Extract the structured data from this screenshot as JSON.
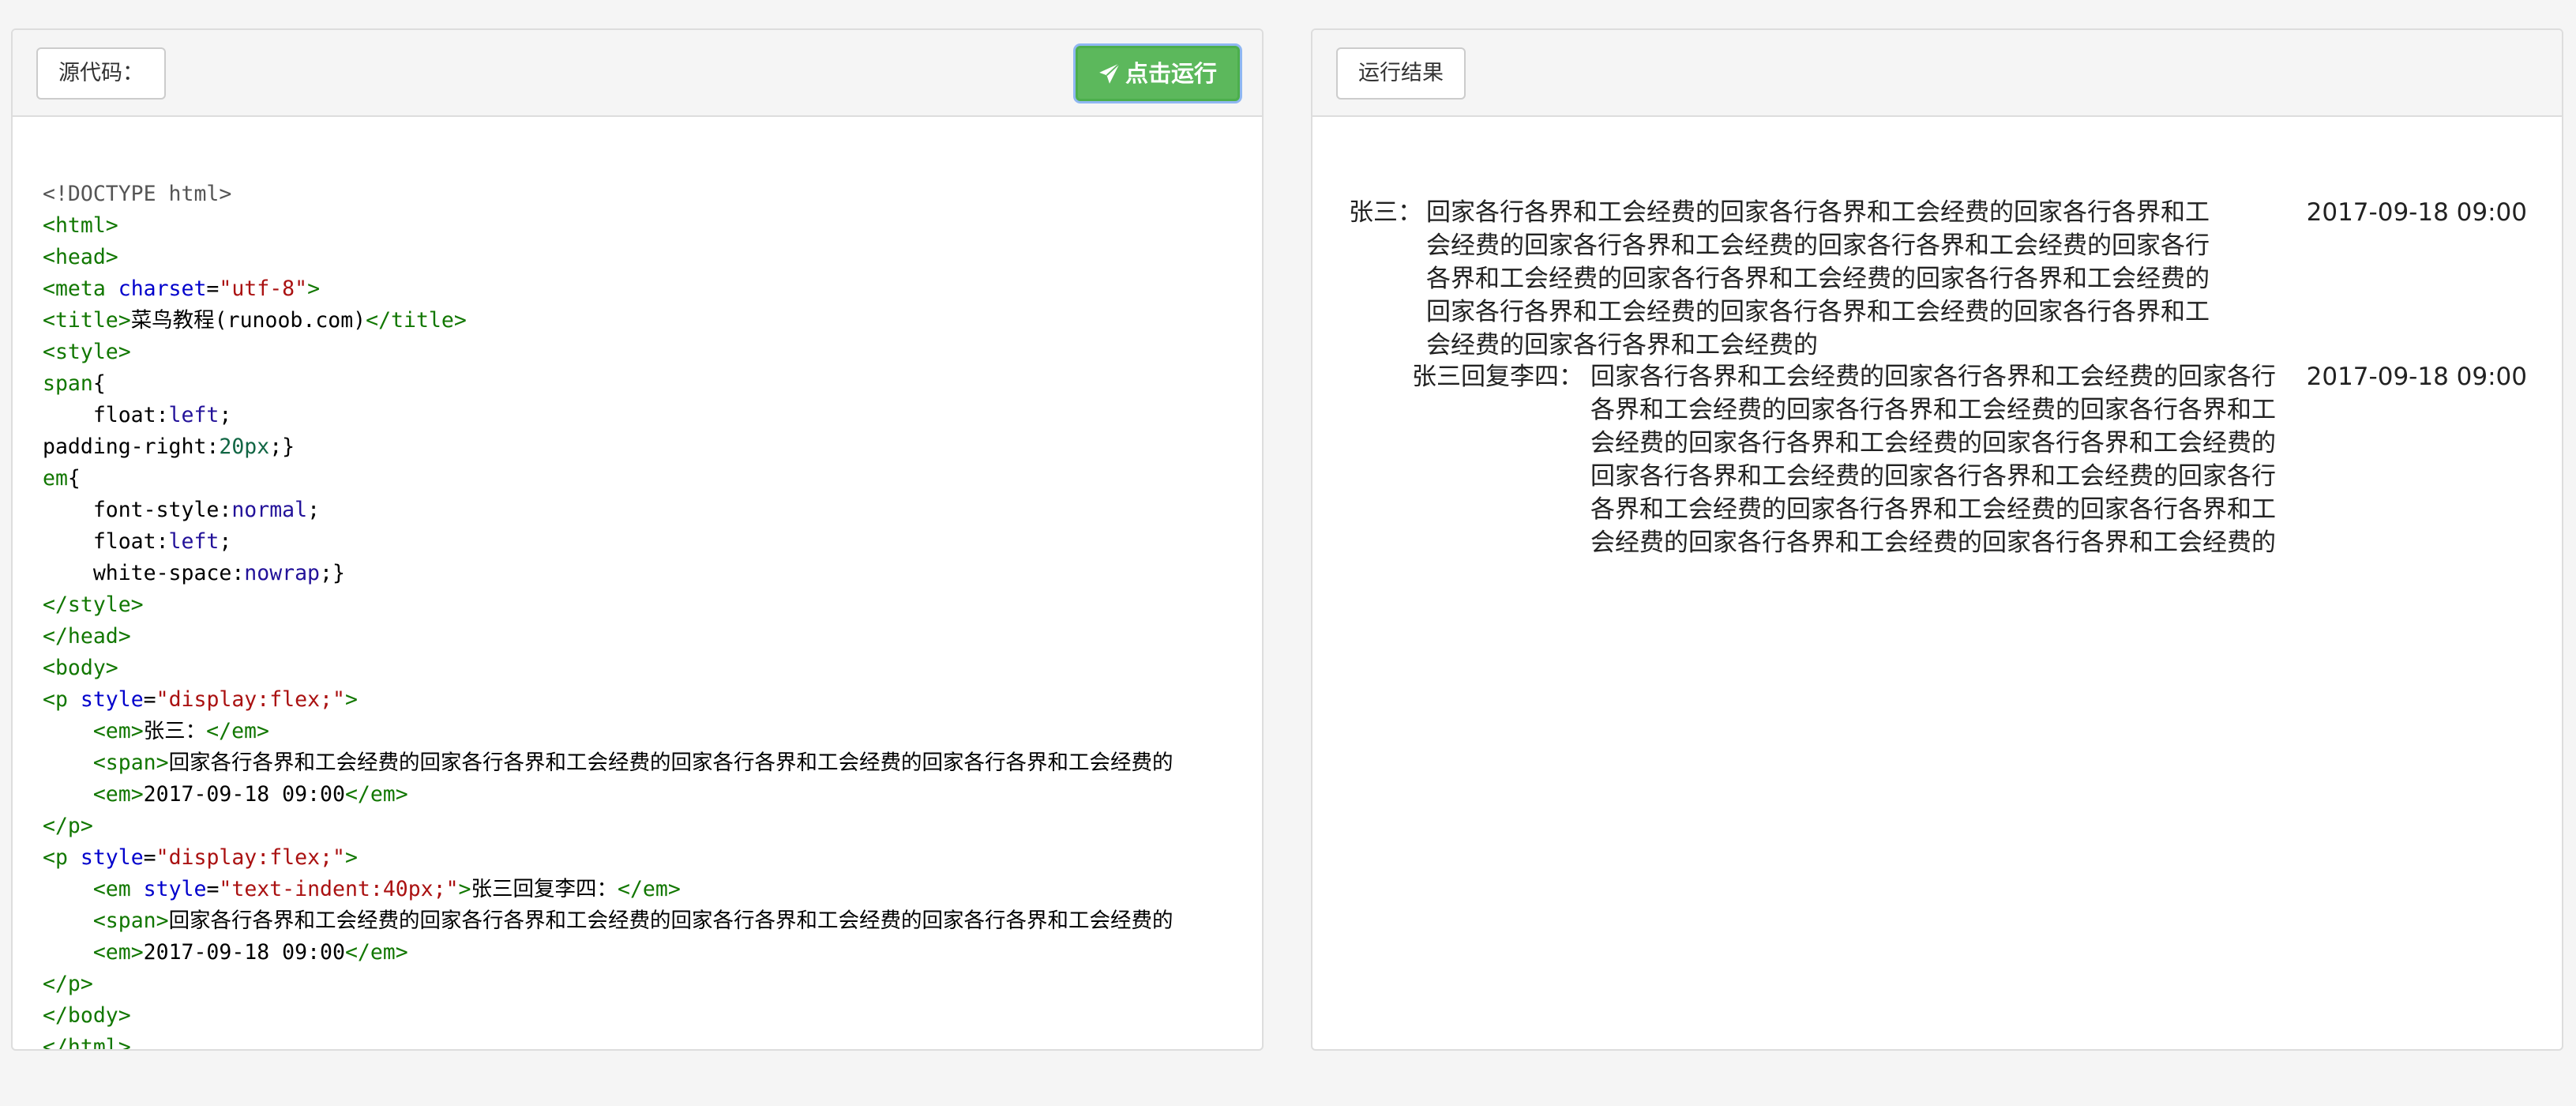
{
  "source_panel": {
    "label": "源代码：",
    "run_button_label": "点击运行",
    "code": [
      [
        {
          "c": "c-doc",
          "t": "<!DOCTYPE html>"
        }
      ],
      [
        {
          "c": "c-tag",
          "t": "<html>"
        }
      ],
      [
        {
          "c": "c-tag",
          "t": "<head>"
        }
      ],
      [
        {
          "c": "c-tag",
          "t": "<meta "
        },
        {
          "c": "c-attr",
          "t": "charset"
        },
        {
          "c": "",
          "t": "="
        },
        {
          "c": "c-str",
          "t": "\"utf-8\""
        },
        {
          "c": "c-tag",
          "t": ">"
        }
      ],
      [
        {
          "c": "c-tag",
          "t": "<title>"
        },
        {
          "c": "",
          "t": "菜鸟教程(runoob.com)"
        },
        {
          "c": "c-tag",
          "t": "</title>"
        }
      ],
      [
        {
          "c": "c-tag",
          "t": "<style>"
        }
      ],
      [
        {
          "c": "c-tag",
          "t": "span"
        },
        {
          "c": "",
          "t": "{"
        }
      ],
      [
        {
          "c": "",
          "t": "    float:"
        },
        {
          "c": "c-kw",
          "t": "left"
        },
        {
          "c": "",
          "t": ";"
        }
      ],
      [
        {
          "c": "",
          "t": "padding-right:"
        },
        {
          "c": "c-num",
          "t": "20px"
        },
        {
          "c": "",
          "t": ";}"
        }
      ],
      [
        {
          "c": "c-tag",
          "t": "em"
        },
        {
          "c": "",
          "t": "{"
        }
      ],
      [
        {
          "c": "",
          "t": "    font-style:"
        },
        {
          "c": "c-kw",
          "t": "normal"
        },
        {
          "c": "",
          "t": ";"
        }
      ],
      [
        {
          "c": "",
          "t": "    float:"
        },
        {
          "c": "c-kw",
          "t": "left"
        },
        {
          "c": "",
          "t": ";"
        }
      ],
      [
        {
          "c": "",
          "t": "    white-space:"
        },
        {
          "c": "c-kw",
          "t": "nowrap"
        },
        {
          "c": "",
          "t": ";}"
        }
      ],
      [
        {
          "c": "c-tag",
          "t": "</style>"
        }
      ],
      [
        {
          "c": "c-tag",
          "t": "</head>"
        }
      ],
      [
        {
          "c": "c-tag",
          "t": "<body>"
        }
      ],
      [
        {
          "c": "c-tag",
          "t": "<p "
        },
        {
          "c": "c-attr",
          "t": "style"
        },
        {
          "c": "",
          "t": "="
        },
        {
          "c": "c-str",
          "t": "\"display:flex;\""
        },
        {
          "c": "c-tag",
          "t": ">"
        }
      ],
      [
        {
          "c": "",
          "t": "    "
        },
        {
          "c": "c-tag",
          "t": "<em>"
        },
        {
          "c": "",
          "t": "张三："
        },
        {
          "c": "c-tag",
          "t": "</em>"
        }
      ],
      [
        {
          "c": "",
          "t": "    "
        },
        {
          "c": "c-tag",
          "t": "<span>"
        },
        {
          "c": "",
          "t": "回家各行各界和工会经费的回家各行各界和工会经费的回家各行各界和工会经费的回家各行各界和工会经费的"
        }
      ],
      [
        {
          "c": "",
          "t": "    "
        },
        {
          "c": "c-tag",
          "t": "<em>"
        },
        {
          "c": "",
          "t": "2017-09-18 09:00"
        },
        {
          "c": "c-tag",
          "t": "</em>"
        }
      ],
      [
        {
          "c": "c-tag",
          "t": "</p>"
        }
      ],
      [
        {
          "c": "c-tag",
          "t": "<p "
        },
        {
          "c": "c-attr",
          "t": "style"
        },
        {
          "c": "",
          "t": "="
        },
        {
          "c": "c-str",
          "t": "\"display:flex;\""
        },
        {
          "c": "c-tag",
          "t": ">"
        }
      ],
      [
        {
          "c": "",
          "t": "    "
        },
        {
          "c": "c-tag",
          "t": "<em "
        },
        {
          "c": "c-attr",
          "t": "style"
        },
        {
          "c": "",
          "t": "="
        },
        {
          "c": "c-str",
          "t": "\"text-indent:40px;\""
        },
        {
          "c": "c-tag",
          "t": ">"
        },
        {
          "c": "",
          "t": "张三回复李四："
        },
        {
          "c": "c-tag",
          "t": "</em>"
        }
      ],
      [
        {
          "c": "",
          "t": "    "
        },
        {
          "c": "c-tag",
          "t": "<span>"
        },
        {
          "c": "",
          "t": "回家各行各界和工会经费的回家各行各界和工会经费的回家各行各界和工会经费的回家各行各界和工会经费的"
        }
      ],
      [
        {
          "c": "",
          "t": "    "
        },
        {
          "c": "c-tag",
          "t": "<em>"
        },
        {
          "c": "",
          "t": "2017-09-18 09:00"
        },
        {
          "c": "c-tag",
          "t": "</em>"
        }
      ],
      [
        {
          "c": "c-tag",
          "t": "</p>"
        }
      ],
      [
        {
          "c": "c-tag",
          "t": "</body>"
        }
      ],
      [
        {
          "c": "c-tag",
          "t": "</html>"
        }
      ]
    ]
  },
  "result_panel": {
    "label": "运行结果",
    "comments": [
      {
        "author": "张三：",
        "text": "回家各行各界和工会经费的回家各行各界和工会经费的回家各行各界和工会经费的回家各行各界和工会经费的回家各行各界和工会经费的回家各行各界和工会经费的回家各行各界和工会经费的回家各行各界和工会经费的回家各行各界和工会经费的回家各行各界和工会经费的回家各行各界和工会经费的回家各行各界和工会经费的",
        "time": "2017-09-18 09:00"
      },
      {
        "author": "张三回复李四：",
        "text": "回家各行各界和工会经费的回家各行各界和工会经费的回家各行各界和工会经费的回家各行各界和工会经费的回家各行各界和工会经费的回家各行各界和工会经费的回家各行各界和工会经费的回家各行各界和工会经费的回家各行各界和工会经费的回家各行各界和工会经费的回家各行各界和工会经费的回家各行各界和工会经费的回家各行各界和工会经费的回家各行各界和工会经费的",
        "time": "2017-09-18 09:00"
      }
    ]
  }
}
